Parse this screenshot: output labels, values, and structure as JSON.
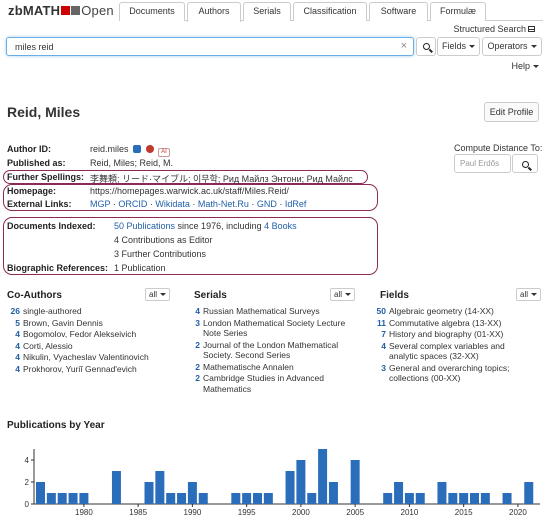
{
  "logo": {
    "brand": "zbMATH",
    "suffix": "Open"
  },
  "tabs": [
    {
      "label": "Documents",
      "active": false
    },
    {
      "label": "Authors",
      "active": true
    },
    {
      "label": "Serials",
      "active": false
    },
    {
      "label": "Classification",
      "active": false
    },
    {
      "label": "Software",
      "active": false
    },
    {
      "label": "Formulæ",
      "active": false
    }
  ],
  "structured_search": "Structured Search",
  "search": {
    "value": "miles reid",
    "fields_label": "Fields",
    "operators_label": "Operators"
  },
  "help": "Help",
  "author": {
    "name": "Reid, Miles",
    "edit_profile": "Edit Profile",
    "author_id_label": "Author ID:",
    "author_id": "reid.miles",
    "ai_badge": "AI",
    "published_as_label": "Published as:",
    "published_as": "Reid, Miles; Reid, M.",
    "further_spellings_label": "Further Spellings:",
    "further_spellings": "李舞頼; リード·マイブル; 이무학; Рид Майлз Энтони; Рид Майлс",
    "homepage_label": "Homepage:",
    "homepage": "https://homepages.warwick.ac.uk/staff/Miles.Reid/",
    "external_links_label": "External Links:",
    "external_links": [
      "MGP",
      "ORCID",
      "Wikidata",
      "Math-Net.Ru",
      "GND",
      "IdRef"
    ],
    "documents_indexed_label": "Documents Indexed:",
    "documents_publications": "50 Publications",
    "documents_since": " since 1976, including ",
    "documents_books": "4 Books",
    "contributions_editor": "4 Contributions as Editor",
    "further_contributions": "3 Further Contributions",
    "bio_refs_label": "Biographic References:",
    "bio_refs": "1 Publication"
  },
  "compute_distance": {
    "label": "Compute Distance To:",
    "placeholder": "Paul Erdős"
  },
  "coauthors": {
    "title": "Co-Authors",
    "filter": "all",
    "items": [
      {
        "count": "26",
        "name": "single-authored"
      },
      {
        "count": "5",
        "name": "Brown, Gavin Dennis"
      },
      {
        "count": "4",
        "name": "Bogomolov, Fedor Alekseivich"
      },
      {
        "count": "4",
        "name": "Corti, Alessio"
      },
      {
        "count": "4",
        "name": "Nikulin, Vyacheslav Valentinovich"
      },
      {
        "count": "4",
        "name": "Prokhorov, Yuriĭ Gennad'evich"
      }
    ]
  },
  "serials": {
    "title": "Serials",
    "filter": "all",
    "items": [
      {
        "count": "4",
        "lines": [
          "Russian Mathematical Surveys"
        ]
      },
      {
        "count": "3",
        "lines": [
          "London Mathematical Society Lecture",
          "Note Series"
        ]
      },
      {
        "count": "2",
        "lines": [
          "Journal of the London Mathematical",
          "Society. Second Series"
        ]
      },
      {
        "count": "2",
        "lines": [
          "Mathematische Annalen"
        ]
      },
      {
        "count": "2",
        "lines": [
          "Cambridge Studies in Advanced",
          "Mathematics"
        ]
      }
    ]
  },
  "fields": {
    "title": "Fields",
    "filter": "all",
    "items": [
      {
        "count": "50",
        "lines": [
          "Algebraic geometry (14-XX)"
        ]
      },
      {
        "count": "11",
        "lines": [
          "Commutative algebra (13-XX)"
        ]
      },
      {
        "count": "7",
        "lines": [
          "History and biography (01-XX)"
        ]
      },
      {
        "count": "4",
        "lines": [
          "Several complex variables and",
          "analytic spaces (32-XX)"
        ]
      },
      {
        "count": "3",
        "lines": [
          "General and overarching topics;",
          "collections (00-XX)"
        ]
      }
    ]
  },
  "chart_data": {
    "type": "bar",
    "title": "Publications by Year",
    "xlabel": "",
    "ylabel": "",
    "ylim": [
      0,
      5
    ],
    "yticks": [
      0,
      2,
      4
    ],
    "xticks": [
      1980,
      1985,
      1990,
      1995,
      2000,
      2005,
      2010,
      2015,
      2020
    ],
    "x": [
      1976,
      1977,
      1978,
      1979,
      1980,
      1983,
      1986,
      1987,
      1988,
      1989,
      1990,
      1991,
      1994,
      1995,
      1996,
      1997,
      1999,
      2000,
      2001,
      2002,
      2003,
      2005,
      2008,
      2009,
      2010,
      2011,
      2013,
      2014,
      2015,
      2016,
      2017,
      2019,
      2021
    ],
    "values": [
      2,
      1,
      1,
      1,
      1,
      3,
      2,
      3,
      1,
      1,
      2,
      1,
      1,
      1,
      1,
      1,
      3,
      4,
      1,
      5,
      2,
      4,
      1,
      2,
      1,
      1,
      2,
      1,
      1,
      1,
      1,
      1,
      2
    ],
    "color": "#2a6ebb",
    "grid": false
  },
  "colors": {
    "accent": "#1f5fa7",
    "frame": "#8b2a55",
    "bar": "#2a6ebb"
  }
}
